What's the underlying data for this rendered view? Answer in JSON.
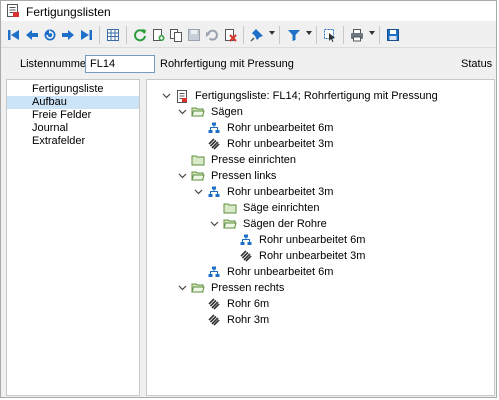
{
  "window": {
    "title": "Fertigungslisten"
  },
  "toolbar": {
    "buttons": [
      {
        "name": "first-record-icon"
      },
      {
        "name": "previous-record-icon"
      },
      {
        "name": "refresh-list-icon"
      },
      {
        "name": "next-record-icon"
      },
      {
        "name": "last-record-icon"
      },
      {
        "name": "table-view-icon"
      },
      {
        "name": "reload-icon"
      },
      {
        "name": "new-record-icon"
      },
      {
        "name": "copy-record-icon"
      },
      {
        "name": "save-icon"
      },
      {
        "name": "undo-icon"
      },
      {
        "name": "delete-icon"
      },
      {
        "name": "pin-icon"
      },
      {
        "name": "filter-icon"
      },
      {
        "name": "select-cursor-icon"
      },
      {
        "name": "print-icon"
      },
      {
        "name": "disk-icon"
      }
    ]
  },
  "info": {
    "listennummer_label": "Listennummer",
    "listennummer_value": "FL14",
    "description": "Rohrfertigung mit Pressung",
    "status_label": "Status"
  },
  "sidebar": {
    "items": [
      {
        "label": "Fertigungsliste",
        "selected": false
      },
      {
        "label": "Aufbau",
        "selected": true
      },
      {
        "label": "Freie Felder",
        "selected": false
      },
      {
        "label": "Journal",
        "selected": false
      },
      {
        "label": "Extrafelder",
        "selected": false
      }
    ]
  },
  "tree": {
    "nodes": [
      {
        "label": "Fertigungsliste: FL14; Rohrfertigung mit Pressung",
        "icon": "document-icon",
        "level": 0,
        "expand": "open"
      },
      {
        "label": "Sägen",
        "icon": "folder-open-icon",
        "level": 1,
        "expand": "open"
      },
      {
        "label": "Rohr unbearbeitet 6m",
        "icon": "assembly-icon",
        "level": 2,
        "expand": "none"
      },
      {
        "label": "Rohr unbearbeitet 3m",
        "icon": "pipe-icon",
        "level": 2,
        "expand": "none"
      },
      {
        "label": "Presse einrichten",
        "icon": "folder-icon",
        "level": 1,
        "expand": "none"
      },
      {
        "label": "Pressen links",
        "icon": "folder-open-icon",
        "level": 1,
        "expand": "open"
      },
      {
        "label": "Rohr unbearbeitet 3m",
        "icon": "assembly-icon",
        "level": 2,
        "expand": "open"
      },
      {
        "label": "Säge einrichten",
        "icon": "folder-icon",
        "level": 3,
        "expand": "none"
      },
      {
        "label": "Sägen der Rohre",
        "icon": "folder-open-icon",
        "level": 3,
        "expand": "open"
      },
      {
        "label": "Rohr unbearbeitet 6m",
        "icon": "assembly-icon",
        "level": 4,
        "expand": "none"
      },
      {
        "label": "Rohr unbearbeitet 3m",
        "icon": "pipe-icon",
        "level": 4,
        "expand": "none"
      },
      {
        "label": "Rohr unbearbeitet 6m",
        "icon": "assembly-icon",
        "level": 2,
        "expand": "none"
      },
      {
        "label": "Pressen rechts",
        "icon": "folder-open-icon",
        "level": 1,
        "expand": "open"
      },
      {
        "label": "Rohr 6m",
        "icon": "pipe-icon",
        "level": 2,
        "expand": "none"
      },
      {
        "label": "Rohr 3m",
        "icon": "pipe-icon",
        "level": 2,
        "expand": "none"
      }
    ]
  },
  "colors": {
    "accent": "#1e6fc8",
    "selection": "#cce4f7",
    "folder": "#e8d58a",
    "green": "#2a9d3a",
    "red": "#d9342b"
  }
}
